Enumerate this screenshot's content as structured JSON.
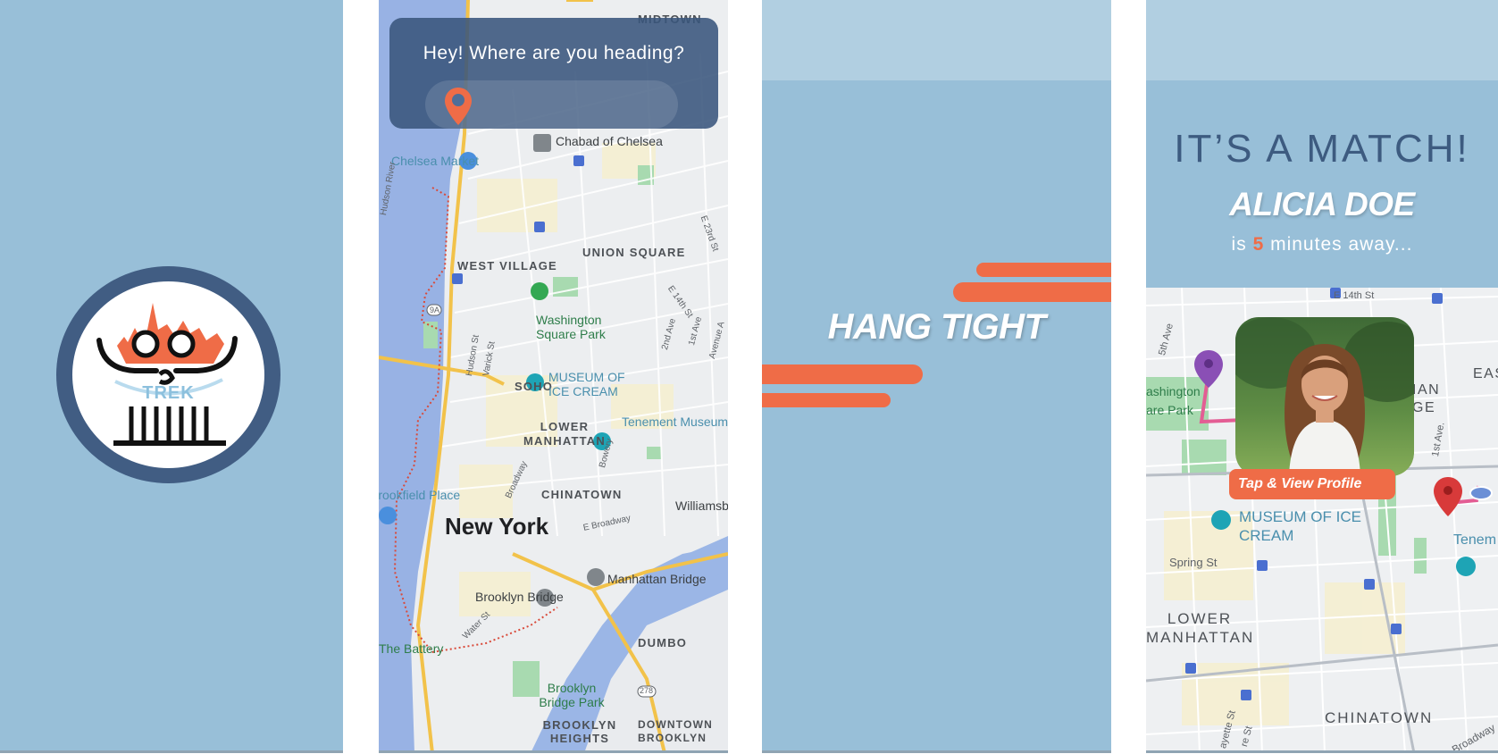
{
  "splash": {
    "logo_text": "TREK",
    "colors": {
      "background": "#98bfd8",
      "ring": "#415d83",
      "accent": "#ef6c47"
    }
  },
  "search_screen": {
    "prompt": "Hey! Where are you heading?",
    "input_value": "",
    "map": {
      "city": "New York",
      "neighborhoods": [
        "MIDTOWN",
        "WEST VILLAGE",
        "UNION SQUARE",
        "SOHO",
        "LOWER MANHATTAN",
        "CHINATOWN",
        "DUMBO",
        "BROOKLYN HEIGHTS",
        "DOWNTOWN BROOKLYN"
      ],
      "places": [
        "Chabad of Chelsea",
        "Chelsea Market",
        "Washington Square Park",
        "MUSEUM OF ICE CREAM",
        "Tenement Museum",
        "Brookfield Place",
        "Brooklyn Bridge",
        "Manhattan Bridge",
        "The Battery",
        "Brooklyn Bridge Park",
        "Williamsburg"
      ],
      "streets": [
        "Hudson St",
        "Varick St",
        "Broadway",
        "Bowery",
        "2nd Ave",
        "1st Ave",
        "Avenue A",
        "E 14th St",
        "E 23rd St",
        "E Broadway",
        "Water St"
      ],
      "water": "Hudson River",
      "route_markers": [
        "9A",
        "278"
      ]
    }
  },
  "loading_screen": {
    "text": "HANG TIGHT"
  },
  "match_screen": {
    "title": "IT’S A MATCH!",
    "name": "ALICIA DOE",
    "subtitle_prefix": "is",
    "minutes": "5",
    "subtitle_suffix": "minutes away...",
    "profile_button": "Tap & View Profile",
    "map": {
      "labels": [
        "E 14th St",
        "5th Ave",
        "ashington",
        "are Park",
        "1st Ave.",
        "EAS",
        "IAN",
        "GE",
        "MUSEUM OF ICE CREAM",
        "Tenem",
        "Spring St",
        "LOWER MANHATTAN",
        "CHINATOWN",
        "Broadway",
        "ayette St",
        "re St"
      ]
    }
  }
}
